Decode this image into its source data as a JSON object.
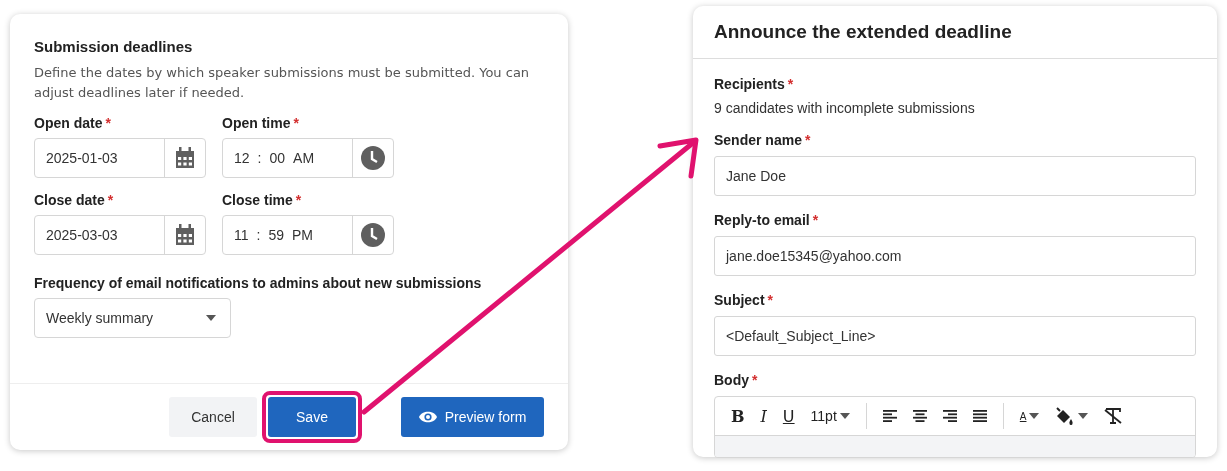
{
  "settings_panel": {
    "title": "Submission deadlines",
    "description": "Define the dates by which speaker submissions must be submitted. You can adjust deadlines later if needed.",
    "fields": [
      {
        "kind": "date",
        "label": "Open date",
        "required_mark": "*",
        "value": "2025-01-03"
      },
      {
        "kind": "time",
        "label": "Open time",
        "required_mark": "*",
        "parts": [
          "12",
          ":",
          "00",
          "AM"
        ]
      },
      {
        "kind": "date",
        "label": "Close date",
        "required_mark": "*",
        "value": "2025-03-03"
      },
      {
        "kind": "time",
        "label": "Close time",
        "required_mark": "*",
        "parts": [
          "11",
          ":",
          "59",
          "PM"
        ]
      }
    ],
    "frequency": {
      "label": "Frequency of email notifications to admins about new submissions",
      "value": "Weekly summary"
    },
    "buttons": [
      {
        "kind": "secondary",
        "label": "Cancel",
        "highlighted": false
      },
      {
        "kind": "primary",
        "label": "Save",
        "highlighted": true
      },
      {
        "kind": "preview",
        "label": "Preview form",
        "highlighted": false
      }
    ]
  },
  "announcement_panel": {
    "title": "Announce the extended deadline",
    "recipients": {
      "label": "Recipients",
      "required_mark": "*",
      "value": "9 candidates with incomplete submissions"
    },
    "fields": [
      {
        "label": "Sender name",
        "required_mark": "*",
        "value": "Jane Doe"
      },
      {
        "label": "Reply-to email",
        "required_mark": "*",
        "value": "jane.doe15345@yahoo.com"
      },
      {
        "label": "Subject",
        "required_mark": "*",
        "value": "<Default_Subject_Line>"
      }
    ],
    "body": {
      "label": "Body",
      "required_mark": "*",
      "toolbar": [
        {
          "kind": "bold",
          "label": "B"
        },
        {
          "kind": "italic",
          "label": "I"
        },
        {
          "kind": "underline",
          "label": "U"
        },
        {
          "kind": "size",
          "label": "11pt"
        },
        {
          "kind": "divider"
        },
        {
          "kind": "align-left"
        },
        {
          "kind": "align-center"
        },
        {
          "kind": "align-right"
        },
        {
          "kind": "align-justify"
        },
        {
          "kind": "divider"
        },
        {
          "kind": "text-color",
          "label": "A"
        },
        {
          "kind": "fill-color"
        },
        {
          "kind": "clear-format"
        }
      ]
    }
  }
}
